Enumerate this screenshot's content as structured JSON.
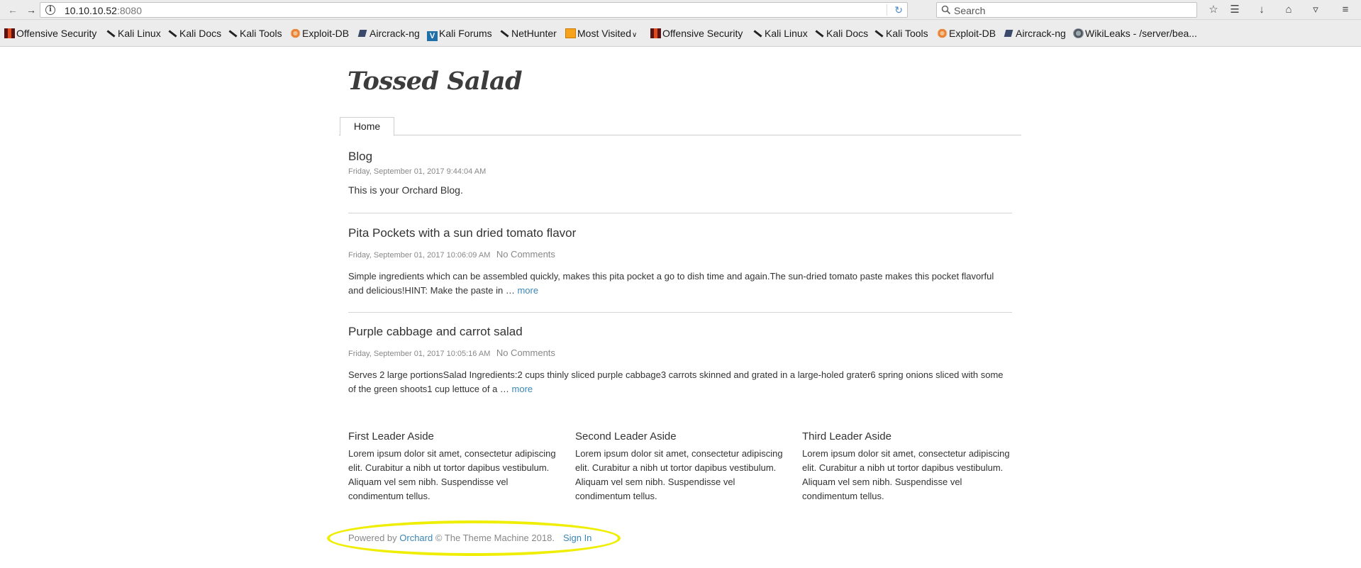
{
  "browser": {
    "url_host": "10.10.10.52",
    "url_port": ":8080",
    "search_placeholder": "Search"
  },
  "bookmarks": [
    {
      "label": "Offensive Security",
      "icon": "offsec-icon"
    },
    {
      "label": "Kali Linux",
      "icon": "kali-dragon-icon"
    },
    {
      "label": "Kali Docs",
      "icon": "kali-dragon-icon"
    },
    {
      "label": "Kali Tools",
      "icon": "kali-dragon-icon"
    },
    {
      "label": "Exploit-DB",
      "icon": "exploit-db-icon"
    },
    {
      "label": "Aircrack-ng",
      "icon": "aircrack-icon"
    },
    {
      "label": "Kali Forums",
      "icon": "kali-forums-icon"
    },
    {
      "label": "NetHunter",
      "icon": "kali-dragon-icon"
    },
    {
      "label": "Most Visited",
      "icon": "folder-icon"
    },
    {
      "label": "Offensive Security",
      "icon": "offsec-icon"
    },
    {
      "label": "Kali Linux",
      "icon": "kali-dragon-icon"
    },
    {
      "label": "Kali Docs",
      "icon": "kali-dragon-icon"
    },
    {
      "label": "Kali Tools",
      "icon": "kali-dragon-icon"
    },
    {
      "label": "Exploit-DB",
      "icon": "exploit-db-icon"
    },
    {
      "label": "Aircrack-ng",
      "icon": "aircrack-icon"
    },
    {
      "label": "WikiLeaks - /server/bea...",
      "icon": "globe-icon"
    }
  ],
  "site": {
    "title": "Tossed Salad",
    "nav_home": "Home"
  },
  "blog": {
    "title": "Blog",
    "date": "Friday, September 01, 2017 9:44:04 AM",
    "intro": "This is your Orchard Blog."
  },
  "posts": [
    {
      "title": "Pita Pockets with a sun dried tomato flavor",
      "date": "Friday, September 01, 2017 10:06:09 AM",
      "comments": "No Comments",
      "excerpt_line1": "Simple ingredients which can be assembled quickly, makes this pita pocket a go to dish time and again.The sun-dried tomato paste makes this pocket flavorful",
      "excerpt_line2": "and delicious!HINT:  Make the paste in … ",
      "more": "more"
    },
    {
      "title": "Purple cabbage and carrot salad",
      "date": "Friday, September 01, 2017 10:05:16 AM",
      "comments": "No Comments",
      "excerpt_line1": "Serves 2 large portionsSalad Ingredients:2 cups thinly sliced purple cabbage3 carrots skinned and grated in a large-holed grater6 spring onions sliced with some",
      "excerpt_line2": "of the green shoots1 cup lettuce of a … ",
      "more": "more"
    }
  ],
  "asides": [
    {
      "title": "First Leader Aside",
      "text": "Lorem ipsum dolor sit amet, consectetur adipiscing elit. Curabitur a nibh ut tortor dapibus vestibulum. Aliquam vel sem nibh. Suspendisse vel condimentum tellus."
    },
    {
      "title": "Second Leader Aside",
      "text": "Lorem ipsum dolor sit amet, consectetur adipiscing elit. Curabitur a nibh ut tortor dapibus vestibulum. Aliquam vel sem nibh. Suspendisse vel condimentum tellus."
    },
    {
      "title": "Third Leader Aside",
      "text": "Lorem ipsum dolor sit amet, consectetur adipiscing elit. Curabitur a nibh ut tortor dapibus vestibulum. Aliquam vel sem nibh. Suspendisse vel condimentum tellus."
    }
  ],
  "footer": {
    "powered_by": "Powered by ",
    "orchard": "Orchard",
    "copyright": " © The Theme Machine 2018.",
    "sign_in": "Sign In"
  },
  "colors": {
    "link": "#3a86b5",
    "highlight": "#f0ee00"
  }
}
